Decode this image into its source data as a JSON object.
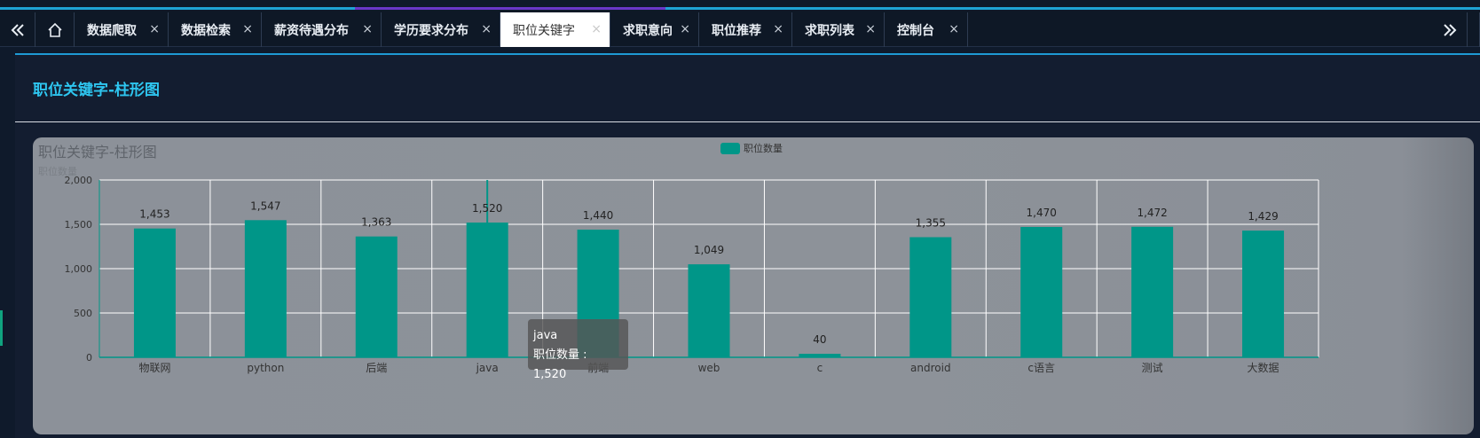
{
  "tabs": [
    {
      "label": "数据爬取"
    },
    {
      "label": "数据检索"
    },
    {
      "label": "薪资待遇分布"
    },
    {
      "label": "学历要求分布"
    },
    {
      "label": "职位关键字",
      "active": true
    },
    {
      "label": "求职意向"
    },
    {
      "label": "职位推荐"
    },
    {
      "label": "求职列表"
    },
    {
      "label": "控制台"
    }
  ],
  "close_glyph": "×",
  "icons": {
    "prev": "double-chevron-left-icon",
    "home": "home-icon",
    "next": "double-chevron-right-icon",
    "close": "close-icon"
  },
  "panel": {
    "title": "职位关键字-柱形图"
  },
  "chart_data": {
    "type": "bar",
    "title": "职位关键字-柱形图",
    "ylabel": "职位数量",
    "legend": "职位数量",
    "legend_position": "top-center",
    "categories": [
      "物联网",
      "python",
      "后端",
      "java",
      "前端",
      "web",
      "c",
      "android",
      "c语言",
      "测试",
      "大数据"
    ],
    "series": [
      {
        "name": "职位数量",
        "values": [
          1453,
          1547,
          1363,
          1520,
          1440,
          1049,
          40,
          1355,
          1470,
          1472,
          1429
        ]
      }
    ],
    "value_labels": [
      "1,453",
      "1,547",
      "1,363",
      "1,520",
      "1,440",
      "1,049",
      "40",
      "1,355",
      "1,470",
      "1,472",
      "1,429"
    ],
    "ylim": [
      0,
      2000
    ],
    "yticks": [
      0,
      500,
      1000,
      1500,
      2000
    ],
    "ytick_labels": [
      "0",
      "500",
      "1,000",
      "1,500",
      "2,000"
    ],
    "grid": true,
    "color": "#009688"
  },
  "tooltip": {
    "category": "java",
    "text": "职位数量 : 1,520"
  }
}
